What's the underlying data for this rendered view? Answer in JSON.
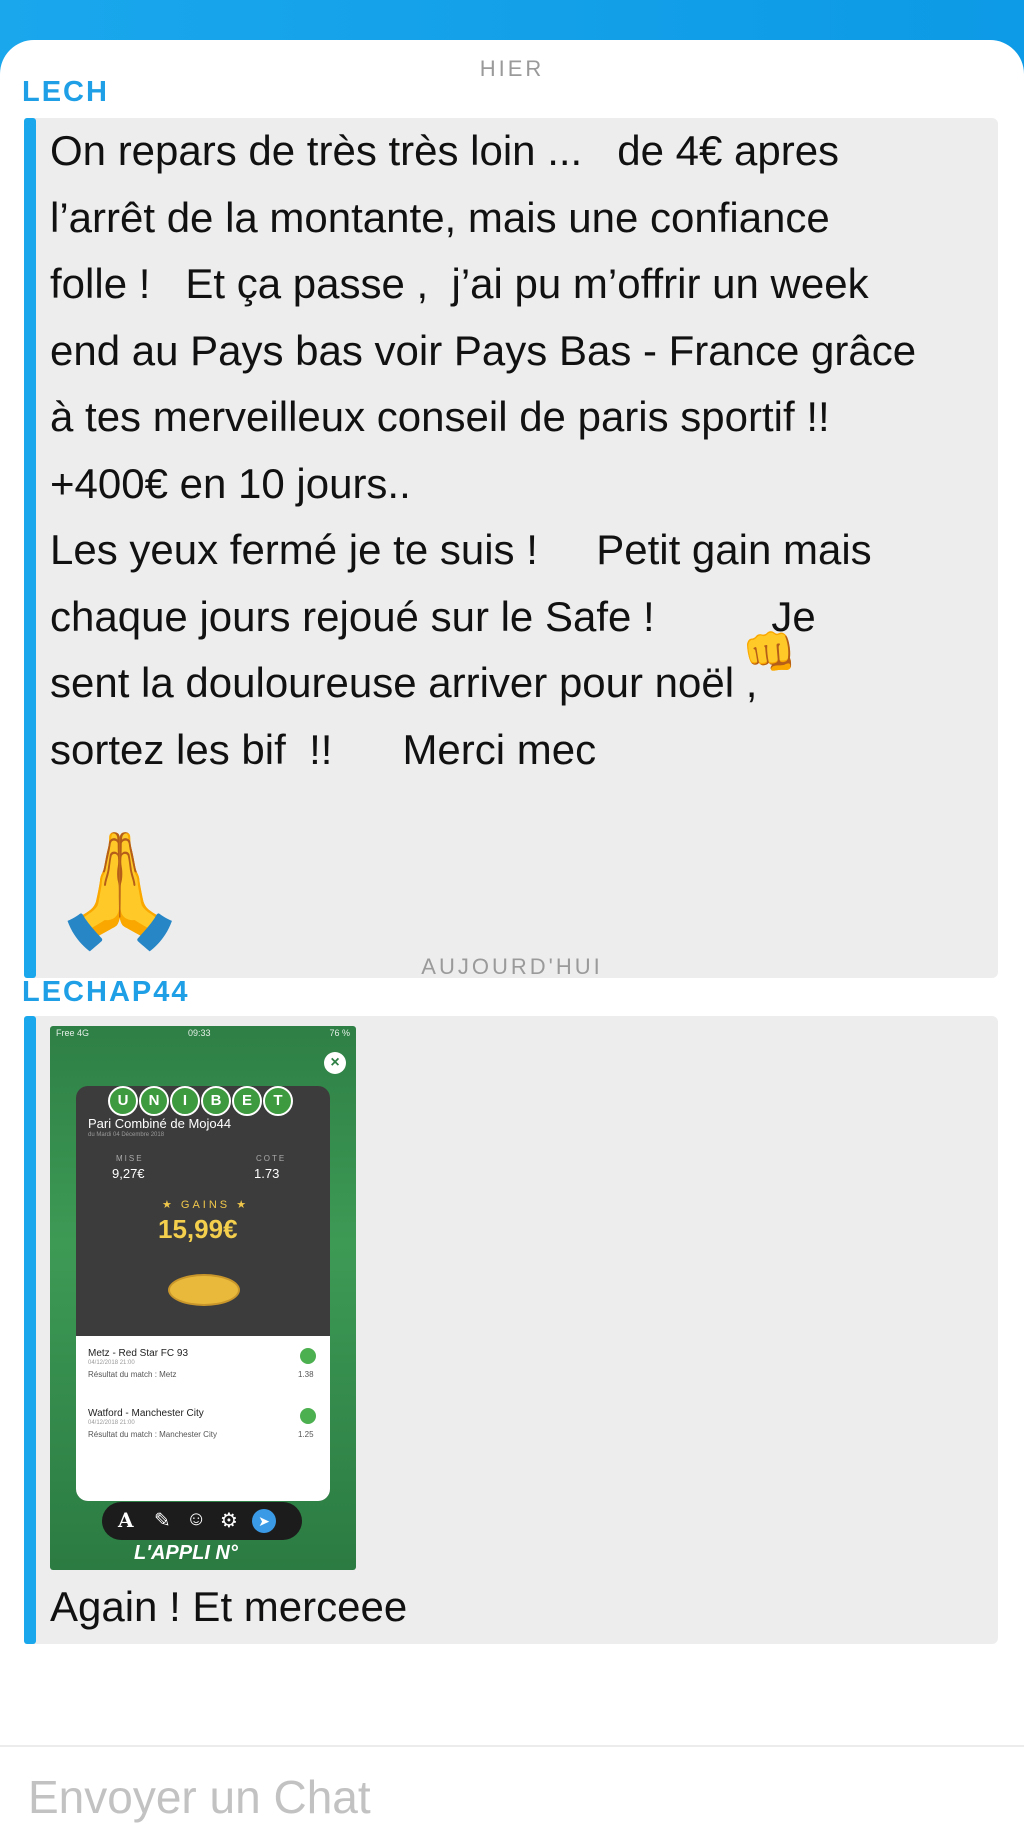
{
  "header": {
    "title": ""
  },
  "day_labels": {
    "yesterday": "HIER",
    "today": "AUJOURD'HUI"
  },
  "messages": [
    {
      "sender": "LECH",
      "text_lines": [
        "On repars de très très loin ...   de 4€ apres",
        "l’arrêt de la montante, mais une confiance",
        "folle !   Et ça passe ,  j’ai pu m’offrir un week",
        "end au Pays bas voir Pays Bas - France grâce",
        "à tes merveilleux conseil de paris sportif !!",
        "+400€ en 10 jours..",
        "Les yeux fermé je te suis !     Petit gain mais",
        "chaque jours rejoué sur le Safe !          Je",
        "sent la douloureuse arriver pour noël ,",
        "sortez les bif  !!      Merci mec"
      ],
      "emoji_inline": "👊",
      "emoji_large": "🙏"
    },
    {
      "sender": "LECHAP44",
      "caption": "Again ! Et merceee",
      "screenshot": {
        "status_carrier": "Free 4G",
        "status_time": "09:33",
        "status_battery": "76 %",
        "brand": [
          "U",
          "N",
          "I",
          "B",
          "E",
          "T"
        ],
        "bet_title": "Pari Combiné de Mojo44",
        "bet_date": "du Mardi 04 Décembre 2018",
        "stake_label": "MISE",
        "stake_value": "9,27€",
        "odds_label": "COTE",
        "odds_value": "1.73",
        "gains_label": "★ GAINS ★",
        "gains_value": "15,99€",
        "matches": [
          {
            "teams": "Metz - Red Star FC 93",
            "datetime": "04/12/2018 21:00",
            "result": "Résultat du match : Metz",
            "odds": "1.38"
          },
          {
            "teams": "Watford - Manchester City",
            "datetime": "04/12/2018 21:00",
            "result": "Résultat du match : Manchester City",
            "odds": "1.25"
          }
        ],
        "footer_text": "L'APPLI N°"
      }
    }
  ],
  "composer": {
    "placeholder": "Envoyer un Chat"
  },
  "colors": {
    "accent": "#1aa7ec",
    "bubble": "#ededee"
  }
}
